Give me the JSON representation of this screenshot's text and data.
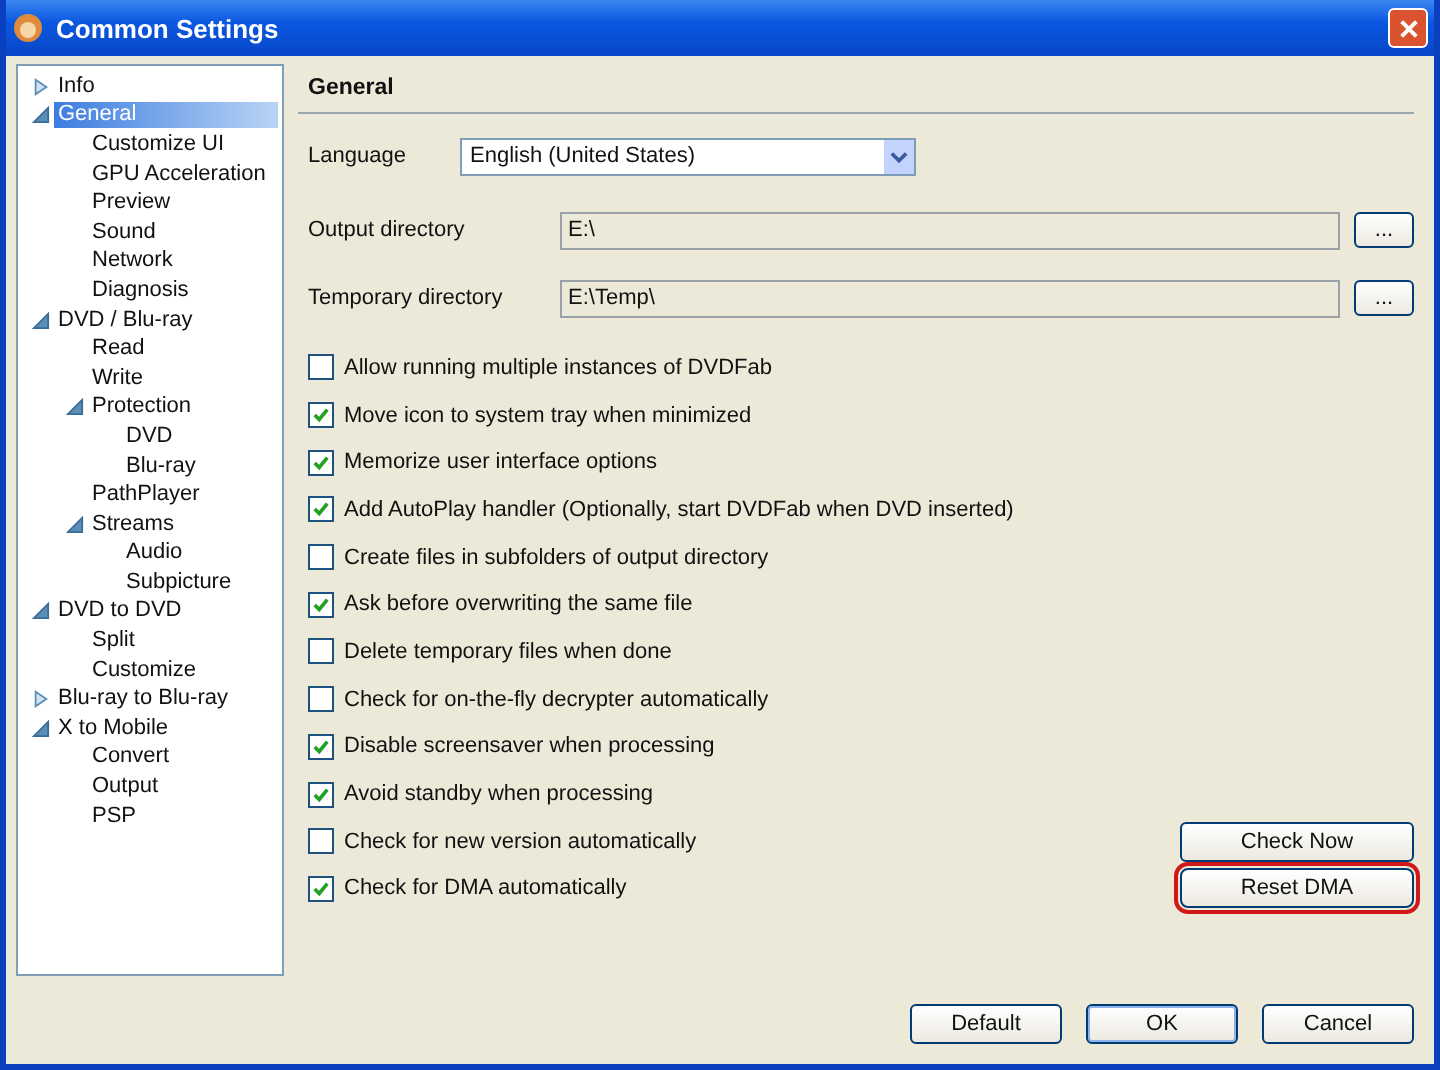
{
  "window": {
    "title": "Common Settings"
  },
  "tree": [
    {
      "label": "Info",
      "expanded": false,
      "selected": false
    },
    {
      "label": "General",
      "expanded": true,
      "selected": true,
      "children": [
        {
          "label": "Customize UI",
          "selected": false
        },
        {
          "label": "GPU Acceleration",
          "selected": false
        },
        {
          "label": "Preview",
          "selected": false
        },
        {
          "label": "Sound",
          "selected": false
        },
        {
          "label": "Network",
          "selected": false
        },
        {
          "label": "Diagnosis",
          "selected": false
        }
      ]
    },
    {
      "label": "DVD / Blu-ray",
      "expanded": true,
      "selected": false,
      "children": [
        {
          "label": "Read",
          "selected": false
        },
        {
          "label": "Write",
          "selected": false
        },
        {
          "label": "Protection",
          "expanded": true,
          "selected": false,
          "children": [
            {
              "label": "DVD",
              "selected": false
            },
            {
              "label": "Blu-ray",
              "selected": false
            }
          ]
        },
        {
          "label": "PathPlayer",
          "selected": false
        },
        {
          "label": "Streams",
          "expanded": true,
          "selected": false,
          "children": [
            {
              "label": "Audio",
              "selected": false
            },
            {
              "label": "Subpicture",
              "selected": false
            }
          ]
        }
      ]
    },
    {
      "label": "DVD to DVD",
      "expanded": true,
      "selected": false,
      "children": [
        {
          "label": "Split",
          "selected": false
        },
        {
          "label": "Customize",
          "selected": false
        }
      ]
    },
    {
      "label": "Blu-ray to Blu-ray",
      "expanded": false,
      "selected": false
    },
    {
      "label": "X to Mobile",
      "expanded": true,
      "selected": false,
      "children": [
        {
          "label": "Convert",
          "selected": false
        },
        {
          "label": "Output",
          "selected": false
        },
        {
          "label": "PSP",
          "selected": false
        }
      ]
    }
  ],
  "panel": {
    "title": "General",
    "language": {
      "label": "Language",
      "value": "English (United States)"
    },
    "directories": [
      {
        "label": "Output directory",
        "value": "E:\\",
        "button": "..."
      },
      {
        "label": "Temporary directory",
        "value": "E:\\Temp\\",
        "button": "..."
      }
    ],
    "options": [
      {
        "label": "Allow running multiple instances of DVDFab",
        "checked": false
      },
      {
        "label": "Move icon to system tray when minimized",
        "checked": true
      },
      {
        "label": "Memorize user interface options",
        "checked": true
      },
      {
        "label": "Add AutoPlay handler (Optionally, start DVDFab when DVD inserted)",
        "checked": true
      },
      {
        "label": "Create files in subfolders of output directory",
        "checked": false
      },
      {
        "label": "Ask before overwriting the same file",
        "checked": true
      },
      {
        "label": "Delete temporary files when done",
        "checked": false
      },
      {
        "label": "Check for on-the-fly decrypter automatically",
        "checked": false
      },
      {
        "label": "Disable screensaver when processing",
        "checked": true
      },
      {
        "label": "Avoid standby when processing",
        "checked": true
      },
      {
        "label": "Check for new version automatically",
        "checked": false,
        "button": {
          "label": "Check Now",
          "highlighted": false
        }
      },
      {
        "label": "Check for DMA automatically",
        "checked": true,
        "button": {
          "label": "Reset DMA",
          "highlighted": true
        }
      }
    ]
  },
  "buttons": [
    {
      "label": "Default",
      "default": false
    },
    {
      "label": "OK",
      "default": true
    },
    {
      "label": "Cancel",
      "default": false
    }
  ]
}
